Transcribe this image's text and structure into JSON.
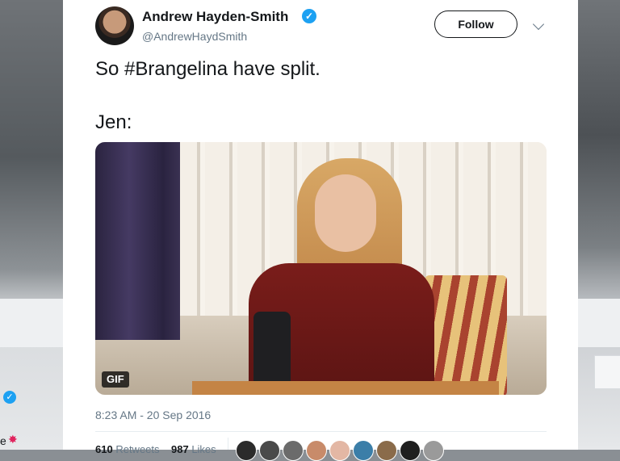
{
  "author": {
    "name": "Andrew Hayden-Smith",
    "handle": "@AndrewHaydSmith",
    "verified_icon": "verified-badge-icon"
  },
  "actions": {
    "follow_label": "Follow",
    "menu_icon": "chevron-down-icon"
  },
  "tweet": {
    "line1": "So #Brangelina have split.",
    "line2": "Jen:"
  },
  "media": {
    "badge": "GIF"
  },
  "meta": {
    "timestamp": "8:23 AM - 20 Sep 2016",
    "retweets_count": "610",
    "retweets_label": "Retweets",
    "likes_count": "987",
    "likes_label": "Likes"
  },
  "liker_colors": [
    "#2b2b2b",
    "#4a4a4a",
    "#6b6b6b",
    "#c88b6a",
    "#e3b7a4",
    "#3b7ea8",
    "#8a6b4a",
    "#1f1f1f",
    "#9a9a9a"
  ]
}
